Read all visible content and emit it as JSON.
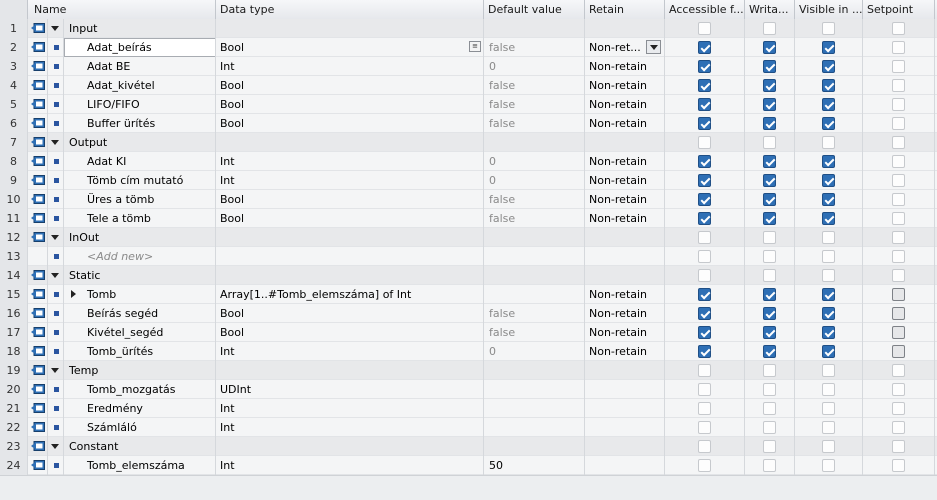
{
  "header": {
    "name": "Name",
    "data_type": "Data type",
    "default_value": "Default value",
    "retain": "Retain",
    "accessible": "Accessible f...",
    "writable": "Writa...",
    "visible": "Visible in ...",
    "setpoint": "Setpoint"
  },
  "rows": [
    {
      "n": "1",
      "kind": "section",
      "name": "Input",
      "type": "",
      "def": "",
      "ret": "",
      "acc": false,
      "wri": false,
      "vis": false,
      "set": false
    },
    {
      "n": "2",
      "kind": "item",
      "name": "Adat_beírás",
      "type": "Bool",
      "def": "false",
      "ret": "Non-ret...",
      "acc": true,
      "wri": true,
      "vis": true,
      "set": false,
      "editing": true
    },
    {
      "n": "3",
      "kind": "item",
      "name": "Adat BE",
      "type": "Int",
      "def": "0",
      "ret": "Non-retain",
      "acc": true,
      "wri": true,
      "vis": true,
      "set": false
    },
    {
      "n": "4",
      "kind": "item",
      "name": "Adat_kivétel",
      "type": "Bool",
      "def": "false",
      "ret": "Non-retain",
      "acc": true,
      "wri": true,
      "vis": true,
      "set": false
    },
    {
      "n": "5",
      "kind": "item",
      "name": "LIFO/FIFO",
      "type": "Bool",
      "def": "false",
      "ret": "Non-retain",
      "acc": true,
      "wri": true,
      "vis": true,
      "set": false
    },
    {
      "n": "6",
      "kind": "item",
      "name": "Buffer ürítés",
      "type": "Bool",
      "def": "false",
      "ret": "Non-retain",
      "acc": true,
      "wri": true,
      "vis": true,
      "set": false
    },
    {
      "n": "7",
      "kind": "section",
      "name": "Output",
      "type": "",
      "def": "",
      "ret": "",
      "acc": false,
      "wri": false,
      "vis": false,
      "set": false
    },
    {
      "n": "8",
      "kind": "item",
      "name": "Adat KI",
      "type": "Int",
      "def": "0",
      "ret": "Non-retain",
      "acc": true,
      "wri": true,
      "vis": true,
      "set": false
    },
    {
      "n": "9",
      "kind": "item",
      "name": "Tömb cím mutató",
      "type": "Int",
      "def": "0",
      "ret": "Non-retain",
      "acc": true,
      "wri": true,
      "vis": true,
      "set": false
    },
    {
      "n": "10",
      "kind": "item",
      "name": "Üres a tömb",
      "type": "Bool",
      "def": "false",
      "ret": "Non-retain",
      "acc": true,
      "wri": true,
      "vis": true,
      "set": false
    },
    {
      "n": "11",
      "kind": "item",
      "name": "Tele a tömb",
      "type": "Bool",
      "def": "false",
      "ret": "Non-retain",
      "acc": true,
      "wri": true,
      "vis": true,
      "set": false
    },
    {
      "n": "12",
      "kind": "section",
      "name": "InOut",
      "type": "",
      "def": "",
      "ret": "",
      "acc": false,
      "wri": false,
      "vis": false,
      "set": false
    },
    {
      "n": "13",
      "kind": "addnew",
      "name": "<Add new>",
      "type": "",
      "def": "",
      "ret": "",
      "acc": false,
      "wri": false,
      "vis": false,
      "set": false
    },
    {
      "n": "14",
      "kind": "section",
      "name": "Static",
      "type": "",
      "def": "",
      "ret": "",
      "acc": false,
      "wri": false,
      "vis": false,
      "set": false
    },
    {
      "n": "15",
      "kind": "array",
      "name": "Tomb",
      "type": "Array[1..#Tomb_elemszáma] of Int",
      "def": "",
      "ret": "Non-retain",
      "acc": true,
      "wri": true,
      "vis": true,
      "set": "grey"
    },
    {
      "n": "16",
      "kind": "item",
      "name": "Beírás segéd",
      "type": "Bool",
      "def": "false",
      "ret": "Non-retain",
      "acc": true,
      "wri": true,
      "vis": true,
      "set": "grey"
    },
    {
      "n": "17",
      "kind": "item",
      "name": "Kivétel_segéd",
      "type": "Bool",
      "def": "false",
      "ret": "Non-retain",
      "acc": true,
      "wri": true,
      "vis": true,
      "set": "grey"
    },
    {
      "n": "18",
      "kind": "item",
      "name": "Tomb_ürítés",
      "type": "Int",
      "def": "0",
      "ret": "Non-retain",
      "acc": true,
      "wri": true,
      "vis": true,
      "set": "grey"
    },
    {
      "n": "19",
      "kind": "section",
      "name": "Temp",
      "type": "",
      "def": "",
      "ret": "",
      "acc": false,
      "wri": false,
      "vis": false,
      "set": false
    },
    {
      "n": "20",
      "kind": "item",
      "name": "Tomb_mozgatás",
      "type": "UDInt",
      "def": "",
      "ret": "",
      "acc": false,
      "wri": false,
      "vis": false,
      "set": false
    },
    {
      "n": "21",
      "kind": "item",
      "name": "Eredmény",
      "type": "Int",
      "def": "",
      "ret": "",
      "acc": false,
      "wri": false,
      "vis": false,
      "set": false
    },
    {
      "n": "22",
      "kind": "item",
      "name": "Számláló",
      "type": "Int",
      "def": "",
      "ret": "",
      "acc": false,
      "wri": false,
      "vis": false,
      "set": false
    },
    {
      "n": "23",
      "kind": "section",
      "name": "Constant",
      "type": "",
      "def": "",
      "ret": "",
      "acc": false,
      "wri": false,
      "vis": false,
      "set": false
    },
    {
      "n": "24",
      "kind": "item",
      "name": "Tomb_elemszáma",
      "type": "Int",
      "def": "50",
      "ret": "",
      "acc": false,
      "wri": false,
      "vis": false,
      "set": false,
      "def_dark": true
    }
  ],
  "icons": {
    "interface": "interface-icon",
    "expand": "collapse-triangle-icon",
    "bullet": "element-bullet-icon"
  }
}
